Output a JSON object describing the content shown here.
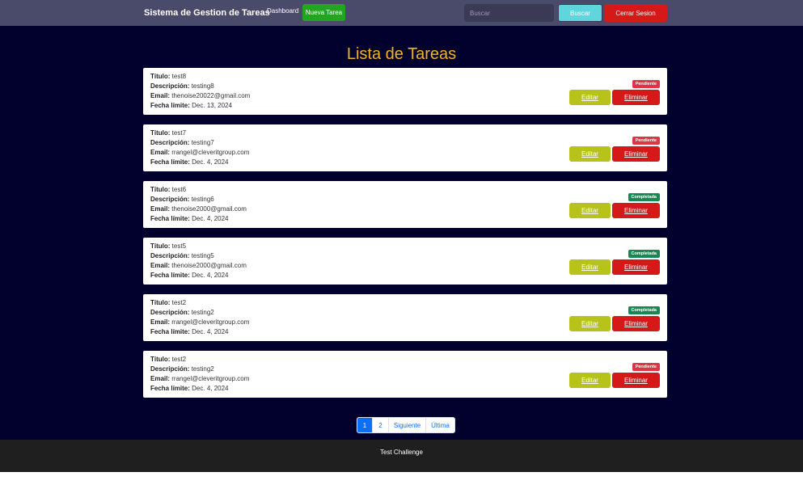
{
  "navbar": {
    "brand": "Sistema de Gestion de Tareas",
    "dashboard_link": "Dashboard",
    "new_task_button": "Nueva Tarea",
    "search_placeholder": "Buscar",
    "search_button": "Buscar",
    "logout_button": "Cerrar Sesion"
  },
  "page": {
    "title": "Lista de Tareas"
  },
  "labels": {
    "title": "Título:",
    "description": "Descripción:",
    "email": "Email:",
    "due_date": "Fecha límite:",
    "edit": "Editar",
    "delete": "Eliminar"
  },
  "tasks": [
    {
      "title": "test8",
      "description": "testing8",
      "email": "thenoise20022@gmail.com",
      "due_date": "Dec. 13, 2024",
      "status": "Pendiente",
      "status_color": "#dc3545"
    },
    {
      "title": "test7",
      "description": "testing7",
      "email": "rrangel@cleveritgroup.com",
      "due_date": "Dec. 4, 2024",
      "status": "Pendiente",
      "status_color": "#dc3545"
    },
    {
      "title": "test6",
      "description": "testing6",
      "email": "thenoise2000@gmail.com",
      "due_date": "Dec. 4, 2024",
      "status": "Completada",
      "status_color": "#198754"
    },
    {
      "title": "test5",
      "description": "testing5",
      "email": "thenoise2000@gmail.com",
      "due_date": "Dec. 4, 2024",
      "status": "Completada",
      "status_color": "#198754"
    },
    {
      "title": "test2",
      "description": "testing2",
      "email": "rrangel@cleveritgroup.com",
      "due_date": "Dec. 4, 2024",
      "status": "Completada",
      "status_color": "#198754"
    },
    {
      "title": "test2",
      "description": "testing2",
      "email": "rrangel@cleveritgroup.com",
      "due_date": "Dec. 4, 2024",
      "status": "Pendiente",
      "status_color": "#dc3545"
    }
  ],
  "pagination": {
    "pages": [
      "1",
      "2"
    ],
    "current_page": "1",
    "next": "Siguiente",
    "last": "Última"
  },
  "footer": {
    "text": "Test Challenge"
  },
  "colors": {
    "navbar_bg": "#4a4a6a",
    "main_bg": "#02012e",
    "title_accent": "#f4b224",
    "new_task_green": "#22a622",
    "search_cyan": "#5fd6dc",
    "danger_red": "#d51818",
    "edit_olive": "#b7c21a",
    "footer_bg": "#1f1f1f"
  }
}
